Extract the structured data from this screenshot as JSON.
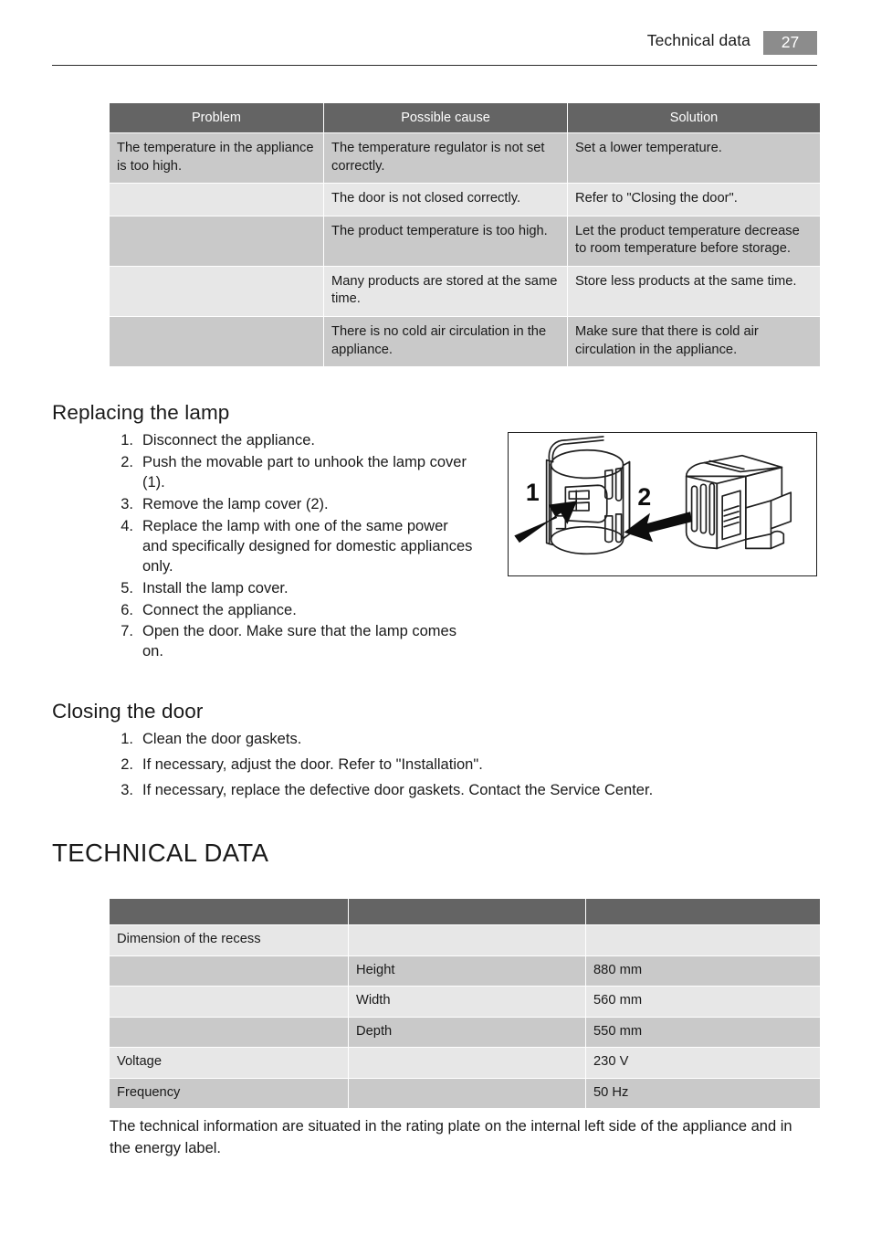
{
  "header": {
    "title": "Technical data",
    "page_number": "27",
    "page_box_color": "#8c8c8c"
  },
  "troubleshooting_table": {
    "columns": [
      "Problem",
      "Possible cause",
      "Solution"
    ],
    "rows": [
      {
        "problem": "The temperature in the appliance is too high.",
        "cause": "The temperature regulator is not set correctly.",
        "solution": "Set a lower temperature."
      },
      {
        "problem": "",
        "cause": "The door is not closed correctly.",
        "solution": "Refer to \"Closing the door\"."
      },
      {
        "problem": "",
        "cause": "The product temperature is too high.",
        "solution": "Let the product temperature decrease to room temperature before storage."
      },
      {
        "problem": "",
        "cause": "Many products are stored at the same time.",
        "solution": "Store less products at the same time."
      },
      {
        "problem": "",
        "cause": "There is no cold air circulation in the appliance.",
        "solution": "Make sure that there is cold air circulation in the appliance."
      }
    ]
  },
  "replacing_lamp": {
    "heading": "Replacing the lamp",
    "steps": [
      {
        "num": "1.",
        "text": "Disconnect the appliance."
      },
      {
        "num": "2.",
        "text": "Push the movable part to unhook the lamp cover (1)."
      },
      {
        "num": "3.",
        "text": "Remove the lamp cover (2)."
      },
      {
        "num": "4.",
        "text": "Replace the lamp with one of the same power and specifically designed for domestic appliances only."
      },
      {
        "num": "5.",
        "text": "Install the lamp cover."
      },
      {
        "num": "6.",
        "text": "Connect the appliance."
      },
      {
        "num": "7.",
        "text": "Open the door. Make sure that the lamp comes on."
      }
    ],
    "figure": {
      "label_1": "1",
      "label_2": "2"
    }
  },
  "closing_door": {
    "heading": "Closing the door",
    "steps": [
      {
        "num": "1.",
        "text": "Clean the door gaskets."
      },
      {
        "num": "2.",
        "text": "If necessary, adjust the door. Refer to \"Installation\"."
      },
      {
        "num": "3.",
        "text": "If necessary, replace the defective door gaskets. Contact the Service Center."
      }
    ]
  },
  "technical_data": {
    "heading": "TECHNICAL DATA",
    "columns": [
      "",
      "",
      ""
    ],
    "rows": [
      {
        "label": "Dimension of the recess",
        "sub": "",
        "value": ""
      },
      {
        "label": "",
        "sub": "Height",
        "value": "880 mm"
      },
      {
        "label": "",
        "sub": "Width",
        "value": "560 mm"
      },
      {
        "label": "",
        "sub": "Depth",
        "value": "550 mm"
      },
      {
        "label": "Voltage",
        "sub": "",
        "value": "230 V"
      },
      {
        "label": "Frequency",
        "sub": "",
        "value": "50 Hz"
      }
    ],
    "note": "The technical information are situated in the rating plate on the internal left side of the appliance and in the energy label."
  }
}
